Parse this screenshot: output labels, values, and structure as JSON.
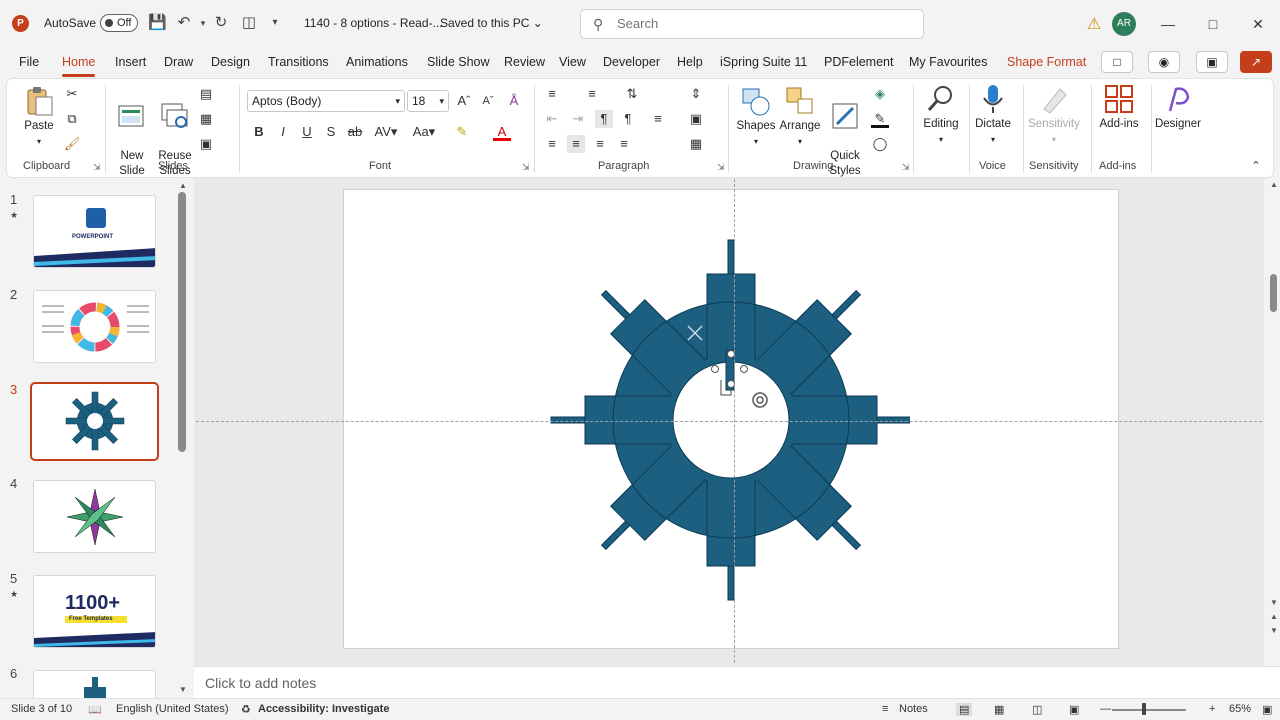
{
  "titlebar": {
    "logo": "P",
    "autosave_label": "AutoSave",
    "autosave_state": "Off",
    "doc_title": "1140 - 8 options  -  Read-...",
    "saved_status": "Saved to this PC ⌄",
    "search_placeholder": "Search",
    "avatar_initials": "AR",
    "window_controls": [
      "—",
      "□",
      "✕"
    ]
  },
  "menu": {
    "tabs": [
      "File",
      "Home",
      "Insert",
      "Draw",
      "Design",
      "Transitions",
      "Animations",
      "Slide Show",
      "Review",
      "View",
      "Developer",
      "Help",
      "iSpring Suite 11",
      "PDFelement",
      "My Favourites",
      "Shape Format"
    ],
    "active_tab": "Home"
  },
  "ribbon": {
    "clipboard": {
      "paste": "Paste",
      "label": "Clipboard"
    },
    "slides": {
      "new_slide": "New\nSlide ⌄",
      "reuse_slides": "Reuse\nSlides",
      "label": "Slides"
    },
    "font": {
      "font_name": "Aptos (Body)",
      "font_size": "18",
      "label": "Font"
    },
    "paragraph": {
      "label": "Paragraph"
    },
    "drawing": {
      "shapes": "Shapes",
      "arrange": "Arrange",
      "quick_styles": "Quick\nStyles ⌄",
      "label": "Drawing"
    },
    "editing": {
      "label": "Editing"
    },
    "voice": {
      "dictate": "Dictate",
      "label": "Voice"
    },
    "sensitivity": {
      "button": "Sensitivity",
      "label": "Sensitivity"
    },
    "addins": {
      "button": "Add-ins",
      "label": "Add-ins"
    },
    "designer": {
      "button": "Designer"
    }
  },
  "thumbnails": {
    "numbers": [
      "1",
      "2",
      "3",
      "4",
      "5",
      "6"
    ],
    "slide1_title": "POWERPOINT",
    "slide5_title": "1100+",
    "slide5_banner": "Free Templates"
  },
  "notes": {
    "placeholder": "Click to add notes"
  },
  "status": {
    "slide_info": "Slide 3 of 10",
    "language": "English (United States)",
    "accessibility": "Accessibility: Investigate",
    "notes_button": "Notes",
    "zoom": "65%"
  },
  "colors": {
    "accent": "#c43e1c",
    "shape_fill": "#1c5f80",
    "shape_stroke": "#0b3a52"
  }
}
